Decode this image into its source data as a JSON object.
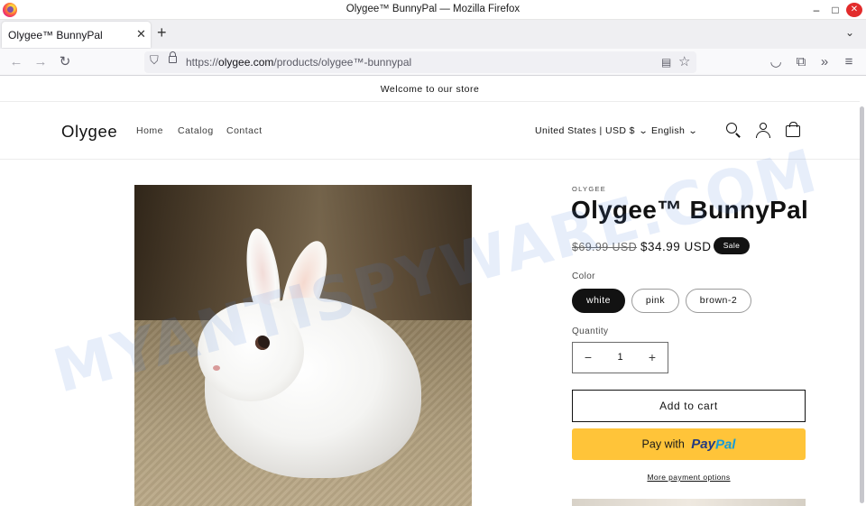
{
  "window": {
    "title": "Olygee™ BunnyPal — Mozilla Firefox",
    "controls": {
      "minimize": "–",
      "maximize": "□",
      "close": "✕"
    }
  },
  "tabs": [
    {
      "label": "Olygee™ BunnyPal",
      "close": "✕",
      "active": true
    }
  ],
  "tabstrip": {
    "new_tab": "+",
    "list_all": "⌄"
  },
  "toolbar": {
    "back_icon": "←",
    "forward_icon": "→",
    "reload_icon": "↻",
    "url_scheme": "https://",
    "url_host": "olygee.com",
    "url_path": "/products/olygee™-bunnypal",
    "reader_icon": "▤",
    "bookmark_icon": "☆",
    "pocket_icon": "◡",
    "extensions_icon": "⧉",
    "overflow_icon": "»",
    "menu_icon": "≡"
  },
  "store": {
    "announcement": "Welcome to our store",
    "brand": "Olygee",
    "menu": [
      "Home",
      "Catalog",
      "Contact"
    ],
    "country_selector": "United States | USD $",
    "language_selector": "English",
    "chevron": "⌄",
    "icons": [
      "search-icon",
      "account-icon",
      "cart-icon"
    ]
  },
  "product": {
    "vendor": "OLYGEE",
    "title": "Olygee™ BunnyPal",
    "compare_price": "$69.99 USD",
    "price": "$34.99 USD",
    "badge": "Sale",
    "color_label": "Color",
    "colors": [
      {
        "label": "white",
        "selected": true
      },
      {
        "label": "pink",
        "selected": false
      },
      {
        "label": "brown-2",
        "selected": false
      }
    ],
    "quantity_label": "Quantity",
    "quantity": "1",
    "qty_minus": "−",
    "qty_plus": "+",
    "add_to_cart": "Add to cart",
    "paypal_prefix": "Pay with",
    "paypal_brand_a": "Pay",
    "paypal_brand_b": "Pal",
    "more_payment": "More payment options"
  },
  "watermark": "MYANTISPYWARE.COM",
  "colors": {
    "accent_dark": "#121212",
    "paypal_yellow": "#ffc439",
    "paypal_navy": "#253b80",
    "paypal_blue": "#179bd7",
    "firefox_close": "#e22b2b"
  }
}
